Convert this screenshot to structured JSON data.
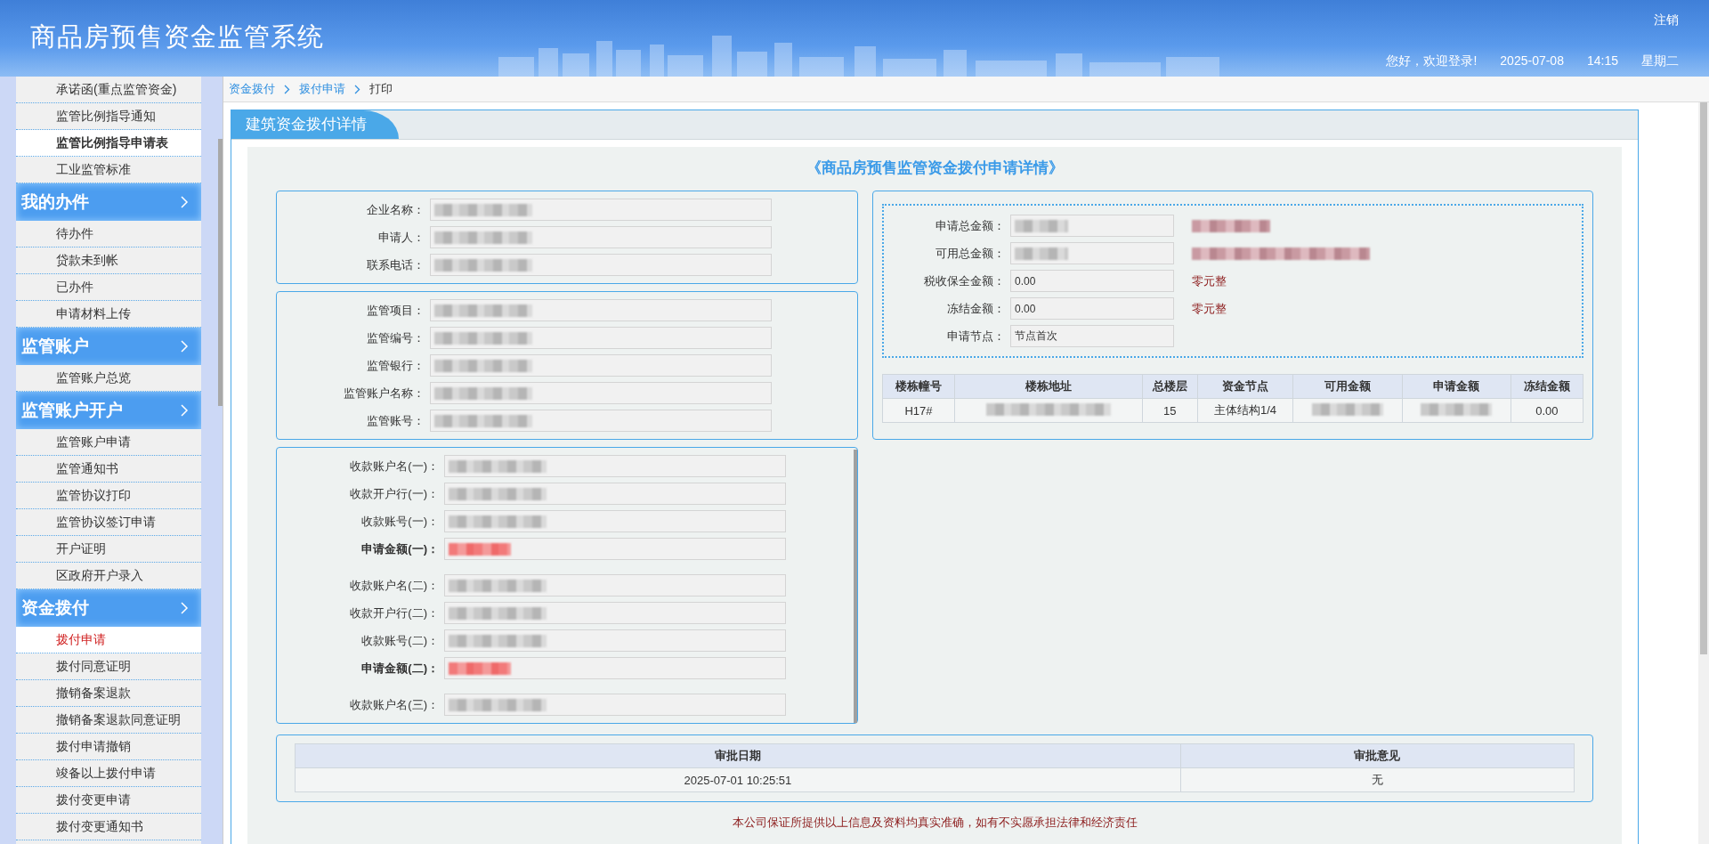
{
  "header": {
    "title": "商品房预售资金监管系统",
    "logout": "注销",
    "greeting": "您好，欢迎登录!",
    "date": "2025-07-08",
    "time": "14:15",
    "weekday": "星期二"
  },
  "sidebar": {
    "entries": [
      {
        "kind": "item",
        "label": "承诺函(重点监管资金)",
        "selected": false,
        "highlighted": false
      },
      {
        "kind": "item",
        "label": "监管比例指导通知",
        "selected": false,
        "highlighted": false
      },
      {
        "kind": "item",
        "label": "监管比例指导申请表",
        "selected": false,
        "highlighted": true
      },
      {
        "kind": "item",
        "label": "工业监管标准",
        "selected": false,
        "highlighted": false
      },
      {
        "kind": "header",
        "label": "我的办件"
      },
      {
        "kind": "item",
        "label": "待办件",
        "selected": false,
        "highlighted": false
      },
      {
        "kind": "item",
        "label": "贷款未到帐",
        "selected": false,
        "highlighted": false
      },
      {
        "kind": "item",
        "label": "已办件",
        "selected": false,
        "highlighted": false
      },
      {
        "kind": "item",
        "label": "申请材料上传",
        "selected": false,
        "highlighted": false
      },
      {
        "kind": "header",
        "label": "监管账户"
      },
      {
        "kind": "item",
        "label": "监管账户总览",
        "selected": false,
        "highlighted": false
      },
      {
        "kind": "header",
        "label": "监管账户开户"
      },
      {
        "kind": "item",
        "label": "监管账户申请",
        "selected": false,
        "highlighted": false
      },
      {
        "kind": "item",
        "label": "监管通知书",
        "selected": false,
        "highlighted": false
      },
      {
        "kind": "item",
        "label": "监管协议打印",
        "selected": false,
        "highlighted": false
      },
      {
        "kind": "item",
        "label": "监管协议签订申请",
        "selected": false,
        "highlighted": false
      },
      {
        "kind": "item",
        "label": "开户证明",
        "selected": false,
        "highlighted": false
      },
      {
        "kind": "item",
        "label": "区政府开户录入",
        "selected": false,
        "highlighted": false
      },
      {
        "kind": "header",
        "label": "资金拨付"
      },
      {
        "kind": "item",
        "label": "拨付申请",
        "selected": true,
        "highlighted": false
      },
      {
        "kind": "item",
        "label": "拨付同意证明",
        "selected": false,
        "highlighted": false
      },
      {
        "kind": "item",
        "label": "撤销备案退款",
        "selected": false,
        "highlighted": false
      },
      {
        "kind": "item",
        "label": "撤销备案退款同意证明",
        "selected": false,
        "highlighted": false
      },
      {
        "kind": "item",
        "label": "拨付申请撤销",
        "selected": false,
        "highlighted": false
      },
      {
        "kind": "item",
        "label": "竣备以上拨付申请",
        "selected": false,
        "highlighted": false
      },
      {
        "kind": "item",
        "label": "拨付变更申请",
        "selected": false,
        "highlighted": false
      },
      {
        "kind": "item",
        "label": "拨付变更通知书",
        "selected": false,
        "highlighted": false
      }
    ]
  },
  "breadcrumb": [
    {
      "label": "资金拨付",
      "current": false
    },
    {
      "label": "拨付申请",
      "current": false
    },
    {
      "label": "打印",
      "current": true
    }
  ],
  "panel": {
    "title": "建筑资金拨付详情",
    "heading": "《商品房预售监管资金拨付申请详情》",
    "applicant": [
      {
        "label": "企业名称：",
        "redacted": true
      },
      {
        "label": "申请人：",
        "redacted": true
      },
      {
        "label": "联系电话：",
        "redacted": true
      }
    ],
    "supervision": [
      {
        "label": "监管项目：",
        "redacted": true
      },
      {
        "label": "监管编号：",
        "redacted": true
      },
      {
        "label": "监管银行：",
        "redacted": true
      },
      {
        "label": "监管账户名称：",
        "redacted": true
      },
      {
        "label": "监管账号：",
        "redacted": true
      }
    ],
    "payees": [
      {
        "fields": [
          {
            "label": "收款账户名(一)：",
            "redacted": true,
            "emphasis": false
          },
          {
            "label": "收款开户行(一)：",
            "redacted": true,
            "emphasis": false
          },
          {
            "label": "收款账号(一)：",
            "redacted": true,
            "emphasis": false
          },
          {
            "label": "申请金额(一)：",
            "redacted": true,
            "emphasis": true
          }
        ]
      },
      {
        "fields": [
          {
            "label": "收款账户名(二)：",
            "redacted": true,
            "emphasis": false
          },
          {
            "label": "收款开户行(二)：",
            "redacted": true,
            "emphasis": false
          },
          {
            "label": "收款账号(二)：",
            "redacted": true,
            "emphasis": false
          },
          {
            "label": "申请金额(二)：",
            "redacted": true,
            "emphasis": true
          }
        ]
      },
      {
        "fields": [
          {
            "label": "收款账户名(三)：",
            "redacted": true,
            "emphasis": false
          }
        ]
      }
    ],
    "amounts": [
      {
        "label": "申请总金额：",
        "redacted": true,
        "words_redacted": true
      },
      {
        "label": "可用总金额：",
        "redacted": true,
        "words_redacted": true
      },
      {
        "label": "税收保全金额：",
        "value": "0.00",
        "words": "零元整"
      },
      {
        "label": "冻结金额：",
        "value": "0.00",
        "words": "零元整"
      },
      {
        "label": "申请节点：",
        "value": "节点首次"
      }
    ],
    "buildings": {
      "columns": [
        "楼栋幢号",
        "楼栋地址",
        "总楼层",
        "资金节点",
        "可用金额",
        "申请金额",
        "冻结金额"
      ],
      "rows": [
        [
          {
            "text": "H17#"
          },
          {
            "redacted": true
          },
          {
            "text": "15"
          },
          {
            "text": "主体结构1/4"
          },
          {
            "redacted": true
          },
          {
            "redacted": true
          },
          {
            "text": "0.00"
          }
        ]
      ]
    },
    "approval": {
      "columns": [
        "审批日期",
        "审批意见"
      ],
      "rows": [
        [
          "2025-07-01 10:25:51",
          "无"
        ]
      ]
    },
    "declaration": "本公司保证所提供以上信息及资料均真实准确，如有不实愿承担法律和经济责任"
  }
}
